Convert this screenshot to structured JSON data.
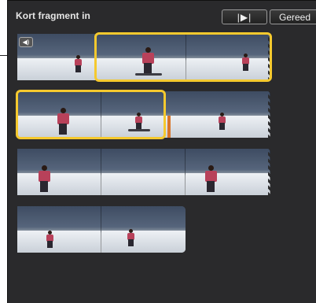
{
  "toolbar": {
    "title": "Kort fragment in",
    "play_label": "|▶|",
    "done_label": "Gereed"
  },
  "clips": {
    "audio_icon": "speaker-icon"
  },
  "colors": {
    "selection": "#f5c92e",
    "playhead": "#d9762b",
    "panel": "#2a2a2c"
  }
}
